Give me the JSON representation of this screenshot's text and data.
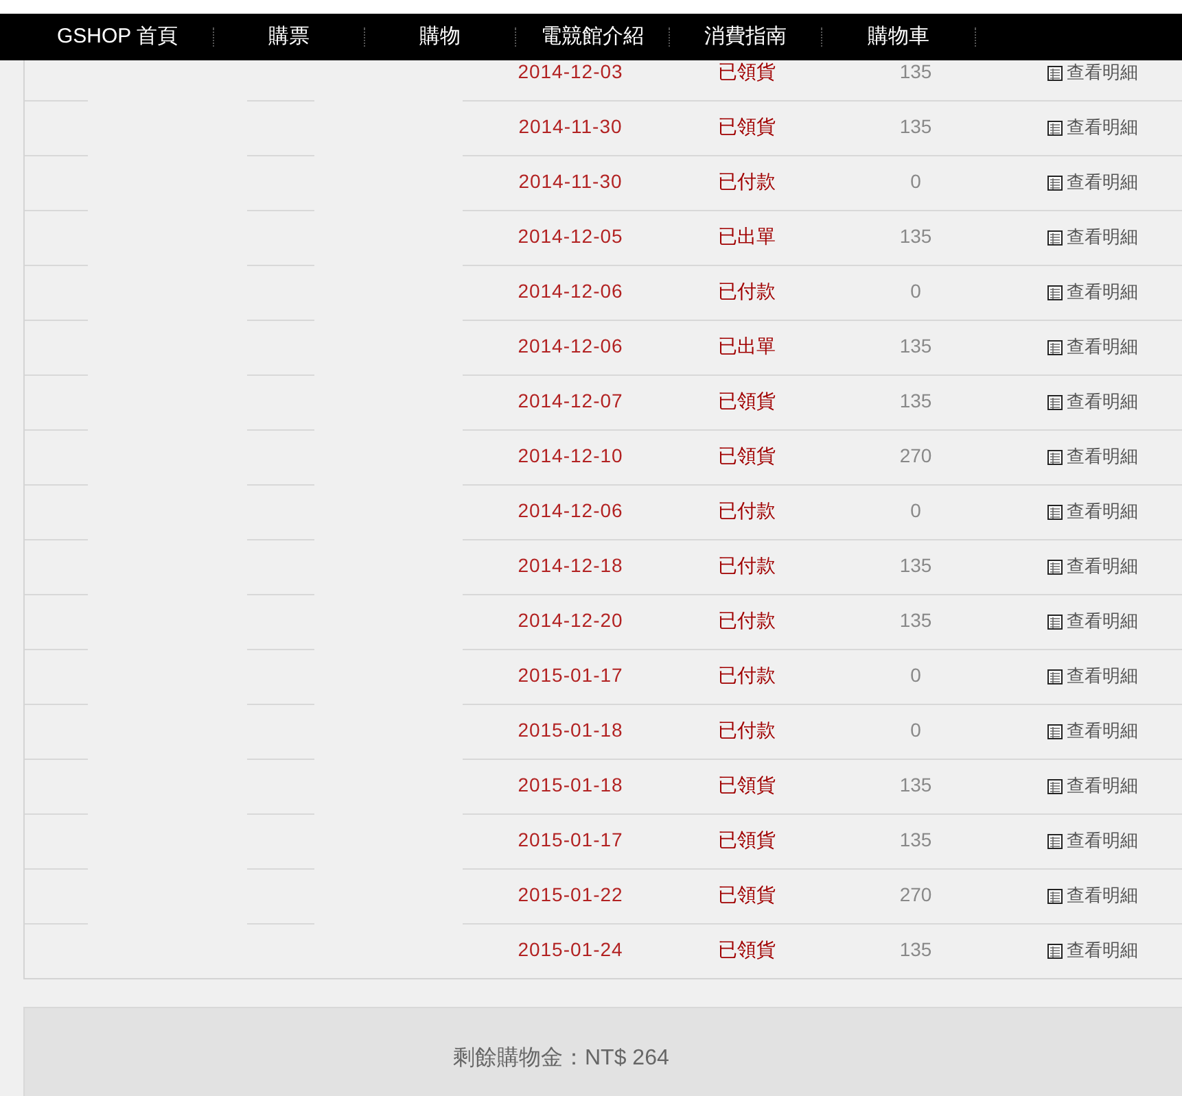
{
  "nav": [
    "GSHOP 首頁",
    "購票",
    "購物",
    "電競館介紹",
    "消費指南",
    "購物車"
  ],
  "orders": [
    {
      "date": "2014-12-03",
      "status": "已領貨",
      "amount": "135",
      "detail": "查看明細"
    },
    {
      "date": "2014-11-30",
      "status": "已領貨",
      "amount": "135",
      "detail": "查看明細"
    },
    {
      "date": "2014-11-30",
      "status": "已付款",
      "amount": "0",
      "detail": "查看明細"
    },
    {
      "date": "2014-12-05",
      "status": "已出單",
      "amount": "135",
      "detail": "查看明細"
    },
    {
      "date": "2014-12-06",
      "status": "已付款",
      "amount": "0",
      "detail": "查看明細"
    },
    {
      "date": "2014-12-06",
      "status": "已出單",
      "amount": "135",
      "detail": "查看明細"
    },
    {
      "date": "2014-12-07",
      "status": "已領貨",
      "amount": "135",
      "detail": "查看明細"
    },
    {
      "date": "2014-12-10",
      "status": "已領貨",
      "amount": "270",
      "detail": "查看明細"
    },
    {
      "date": "2014-12-06",
      "status": "已付款",
      "amount": "0",
      "detail": "查看明細"
    },
    {
      "date": "2014-12-18",
      "status": "已付款",
      "amount": "135",
      "detail": "查看明細"
    },
    {
      "date": "2014-12-20",
      "status": "已付款",
      "amount": "135",
      "detail": "查看明細"
    },
    {
      "date": "2015-01-17",
      "status": "已付款",
      "amount": "0",
      "detail": "查看明細"
    },
    {
      "date": "2015-01-18",
      "status": "已付款",
      "amount": "0",
      "detail": "查看明細"
    },
    {
      "date": "2015-01-18",
      "status": "已領貨",
      "amount": "135",
      "detail": "查看明細"
    },
    {
      "date": "2015-01-17",
      "status": "已領貨",
      "amount": "135",
      "detail": "查看明細"
    },
    {
      "date": "2015-01-22",
      "status": "已領貨",
      "amount": "270",
      "detail": "查看明細"
    },
    {
      "date": "2015-01-24",
      "status": "已領貨",
      "amount": "135",
      "detail": "查看明細"
    }
  ],
  "balance": "剩餘購物金：NT$ 264"
}
